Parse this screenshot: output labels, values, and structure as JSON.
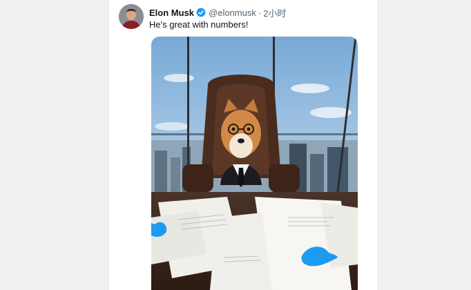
{
  "tweet": {
    "author_name": "Elon Musk",
    "handle": "@elonmusk",
    "separator": "·",
    "timestamp": "2小时",
    "text": "He's great with numbers!",
    "verified": true,
    "verified_color": "#1d9bf0",
    "avatar_icon": "profile-photo",
    "media_icon": "shiba-ceo-photo"
  },
  "colors": {
    "page_bg": "#eef0f2",
    "card_bg": "#ffffff",
    "name_color": "#0f1419",
    "meta_color": "#536471",
    "twitter_blue": "#1d9bf0"
  }
}
